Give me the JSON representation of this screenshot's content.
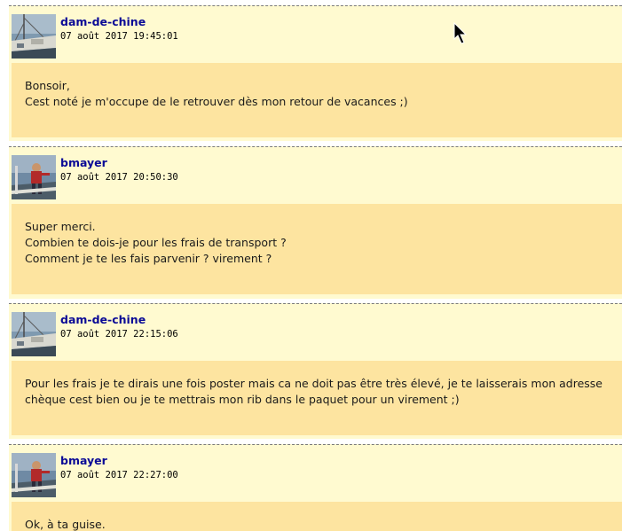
{
  "posts": [
    {
      "author": "dam-de-chine",
      "date": "07 août 2017 19:45:01",
      "avatar": "boat-avatar",
      "lines": [
        "Bonsoir,",
        "Cest noté je m'occupe de le retrouver dès mon retour de vacances ;)"
      ]
    },
    {
      "author": "bmayer",
      "date": "07 août 2017 20:50:30",
      "avatar": "person-avatar",
      "lines": [
        "Super merci.",
        "Combien te dois-je pour les frais de transport ?",
        "Comment je te les fais parvenir ? virement ?"
      ]
    },
    {
      "author": "dam-de-chine",
      "date": "07 août 2017 22:15:06",
      "avatar": "boat-avatar",
      "lines": [
        "Pour les frais je te dirais une fois poster mais ca ne doit pas être très élevé, je te laisserais mon adresse",
        "chèque cest bien ou je te mettrais mon rib dans le paquet pour un virement ;)"
      ]
    },
    {
      "author": "bmayer",
      "date": "07 août 2017 22:27:00",
      "avatar": "person-avatar",
      "lines": [
        "Ok, à ta guise."
      ]
    }
  ],
  "colors": {
    "post_background": "#fffad0",
    "body_background": "#fde4a0",
    "author_color": "#0a0a96",
    "separator": "#7a7a7a"
  }
}
